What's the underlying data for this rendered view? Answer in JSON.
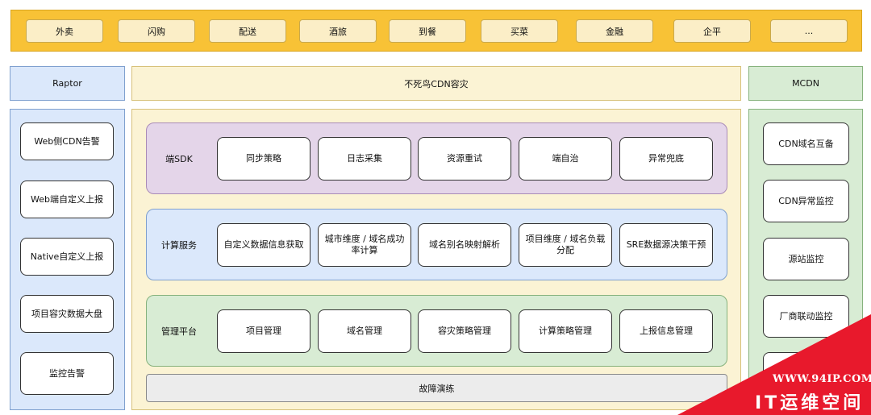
{
  "business_bar": {
    "items": [
      "外卖",
      "闪购",
      "配送",
      "酒旅",
      "到餐",
      "买菜",
      "金融",
      "企平",
      "..."
    ]
  },
  "headers": {
    "left": "Raptor",
    "center": "不死鸟CDN容灾",
    "right": "MCDN"
  },
  "left_column": {
    "items": [
      "Web侧CDN告警",
      "Web端自定义上报",
      "Native自定义上报",
      "项目容灾数据大盘",
      "监控告警"
    ]
  },
  "right_column": {
    "items": [
      "CDN域名互备",
      "CDN异常监控",
      "源站监控",
      "厂商联动监控",
      ""
    ]
  },
  "bands": {
    "sdk": {
      "label": "端SDK",
      "items": [
        "同步策略",
        "日志采集",
        "资源重试",
        "端自治",
        "异常兜底"
      ]
    },
    "compute": {
      "label": "计算服务",
      "items": [
        "自定义数据信息获取",
        "城市维度 / 域名成功率计算",
        "域名别名映射解析",
        "项目维度 / 域名负载分配",
        "SRE数据源决策干预"
      ]
    },
    "manage": {
      "label": "管理平台",
      "items": [
        "项目管理",
        "域名管理",
        "容灾策略管理",
        "计算策略管理",
        "上报信息管理"
      ]
    }
  },
  "fault_drill": "故障演练",
  "watermark": {
    "url": "WWW.94IP.COM",
    "title": "IT运维空间",
    "color": "#e8192c"
  }
}
